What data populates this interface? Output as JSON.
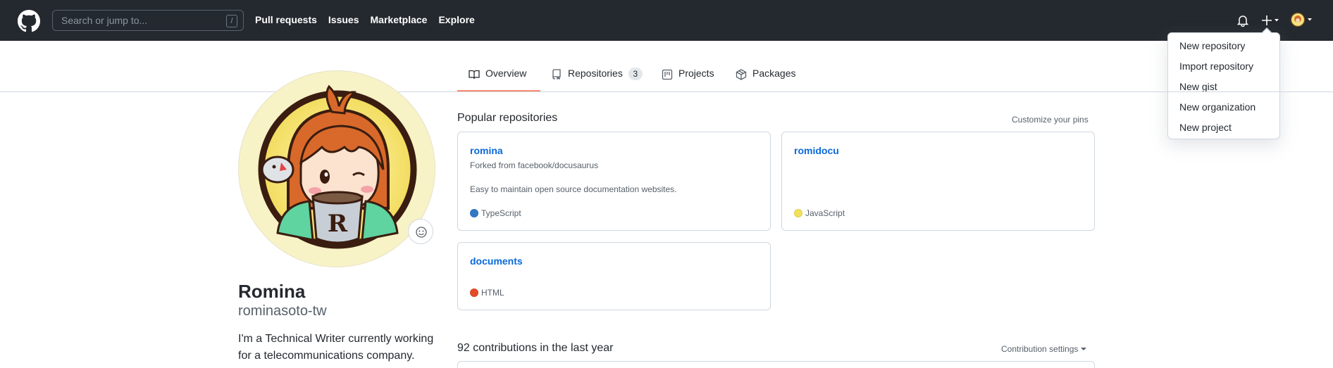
{
  "header": {
    "search_placeholder": "Search or jump to...",
    "search_shortcut": "/",
    "nav": [
      "Pull requests",
      "Issues",
      "Marketplace",
      "Explore"
    ]
  },
  "tabs": [
    {
      "label": "Overview",
      "icon": "book-icon",
      "active": true
    },
    {
      "label": "Repositories",
      "icon": "repo-icon",
      "count": "3"
    },
    {
      "label": "Projects",
      "icon": "project-icon"
    },
    {
      "label": "Packages",
      "icon": "package-icon"
    }
  ],
  "profile": {
    "name": "Romina",
    "login": "rominasoto-tw",
    "bio_line1": "I'm a Technical Writer currently working",
    "bio_line2": "for a telecommunications company."
  },
  "popular": {
    "title": "Popular repositories",
    "customize": "Customize your pins",
    "repos": [
      {
        "name": "romina",
        "fork": "Forked from facebook/docusaurus",
        "description": "Easy to maintain open source documentation websites.",
        "language": "TypeScript",
        "color": "#3178c6"
      },
      {
        "name": "romidocu",
        "language": "JavaScript",
        "color": "#f1e05a"
      },
      {
        "name": "documents",
        "language": "HTML",
        "color": "#e34c26"
      }
    ]
  },
  "contributions": {
    "title": "92 contributions in the last year",
    "settings": "Contribution settings"
  },
  "dropdown": {
    "items": [
      "New repository",
      "Import repository",
      "New gist",
      "New organization",
      "New project"
    ]
  },
  "colors": {
    "header_bg": "#24292f",
    "link": "#0969da",
    "active_tab": "#fd8c73"
  }
}
